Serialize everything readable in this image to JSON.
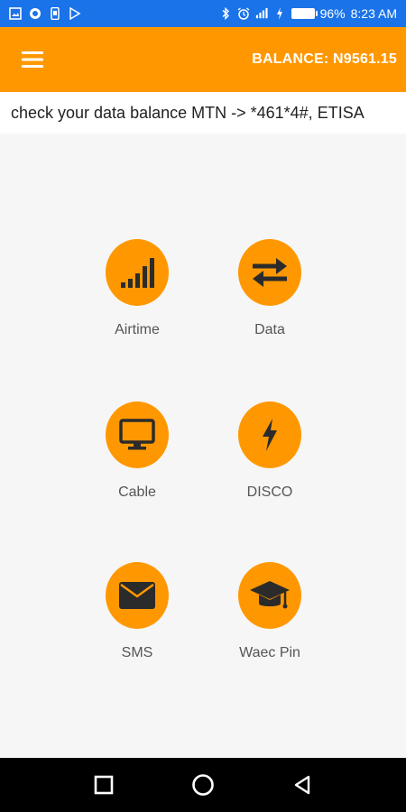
{
  "status_bar": {
    "battery_percent": "96%",
    "time": "8:23 AM"
  },
  "app_bar": {
    "balance": "BALANCE: N9561.15"
  },
  "marquee": {
    "text": "check your data balance MTN -> *461*4#, ETISA"
  },
  "services": [
    {
      "label": "Airtime",
      "icon": "signal-bars-icon"
    },
    {
      "label": "Data",
      "icon": "swap-arrows-icon"
    },
    {
      "label": "Cable",
      "icon": "monitor-icon"
    },
    {
      "label": "DISCO",
      "icon": "lightning-icon"
    },
    {
      "label": "SMS",
      "icon": "envelope-icon"
    },
    {
      "label": "Waec Pin",
      "icon": "graduation-cap-icon"
    }
  ],
  "colors": {
    "status_bar": "#1a73e8",
    "accent": "#ff9800",
    "icon_dark": "#2b2b2b"
  }
}
